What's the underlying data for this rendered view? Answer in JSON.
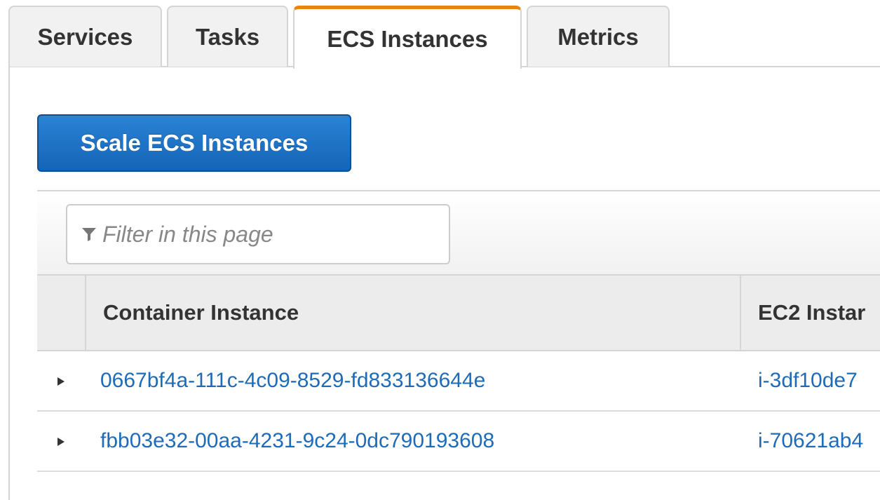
{
  "tabs": [
    {
      "label": "Services",
      "active": false
    },
    {
      "label": "Tasks",
      "active": false
    },
    {
      "label": "ECS Instances",
      "active": true
    },
    {
      "label": "Metrics",
      "active": false
    }
  ],
  "toolbar": {
    "scale_button_label": "Scale ECS Instances"
  },
  "filter": {
    "placeholder": "Filter in this page",
    "icon": "filter-icon"
  },
  "table": {
    "columns": [
      "Container Instance",
      "EC2 Instar"
    ],
    "rows": [
      {
        "container_instance": "0667bf4a-111c-4c09-8529-fd833136644e",
        "ec2_instance": "i-3df10de7"
      },
      {
        "container_instance": "fbb03e32-00aa-4231-9c24-0dc790193608",
        "ec2_instance": "i-70621ab4"
      }
    ]
  },
  "colors": {
    "active_tab_accent": "#e7840d",
    "primary_button": "#1564b8",
    "link": "#1e6bb8"
  }
}
